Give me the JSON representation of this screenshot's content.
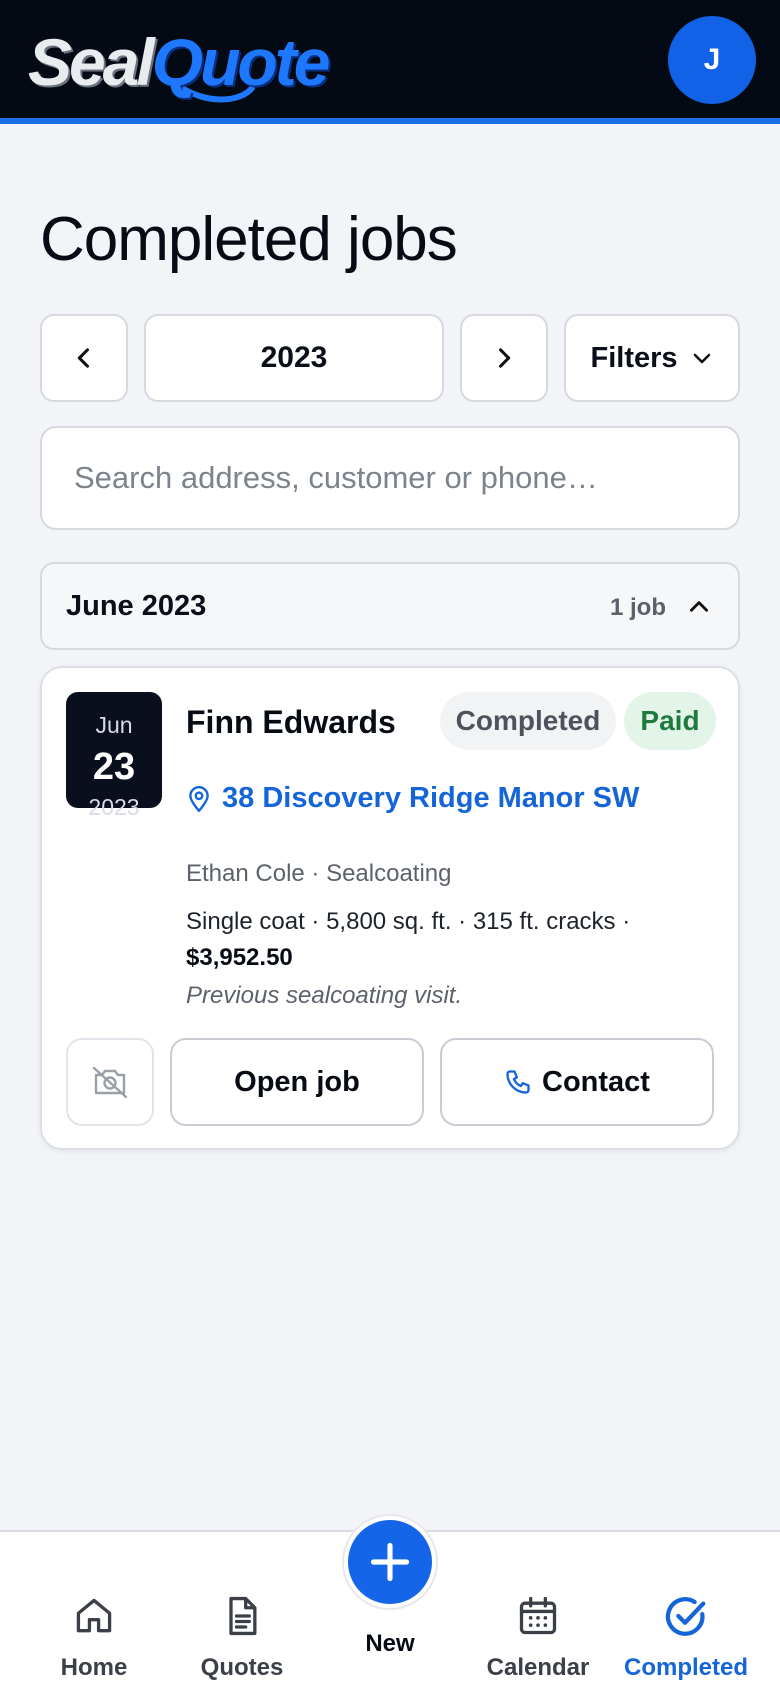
{
  "header": {
    "logo_part1": "Seal",
    "logo_part2": "Quote",
    "avatar_initial": "J"
  },
  "page": {
    "title": "Completed jobs"
  },
  "year_nav": {
    "prev_icon": "chevron-left-icon",
    "year": "2023",
    "next_icon": "chevron-right-icon",
    "filters_label": "Filters"
  },
  "search": {
    "placeholder": "Search address, customer or phone…",
    "value": ""
  },
  "month_group": {
    "label": "June 2023",
    "count": "1 job",
    "expanded": true
  },
  "jobs": [
    {
      "date_month": "Jun",
      "date_day": "23",
      "date_year": "2023",
      "customer": "Finn Edwards",
      "status": "Completed",
      "payment": "Paid",
      "address": "38 Discovery Ridge Manor SW",
      "meta": "Ethan Cole · Sealcoating",
      "details": "Single coat · 5,800 sq. ft. · 315 ft. cracks ·",
      "price": "$3,952.50",
      "note": "Previous sealcoating visit.",
      "open_label": "Open job",
      "contact_label": "Contact"
    }
  ],
  "bottom_nav": {
    "home": "Home",
    "quotes": "Quotes",
    "new": "New",
    "calendar": "Calendar",
    "completed": "Completed",
    "active": "completed"
  },
  "colors": {
    "accent": "#1565d8",
    "header_bg": "#040a14",
    "paid_text": "#1f7a3d",
    "paid_bg": "#e3f4e8"
  }
}
